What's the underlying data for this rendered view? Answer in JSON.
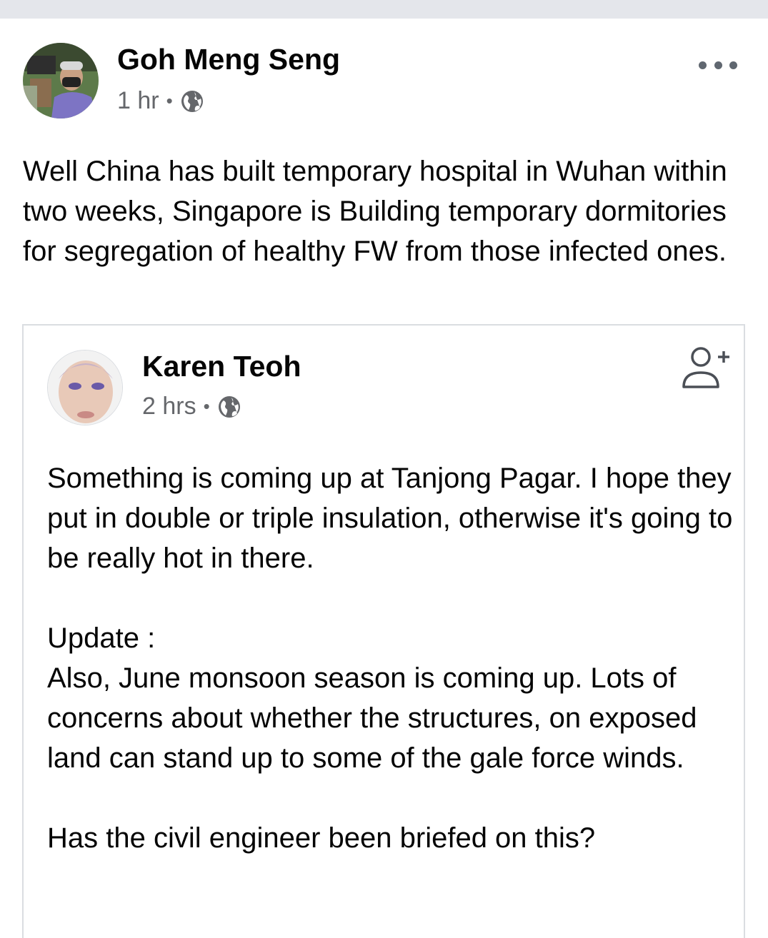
{
  "post": {
    "author": "Goh Meng Seng",
    "time": "1 hr",
    "separator": "•",
    "privacy_icon": "globe-icon",
    "menu_icon": "more-options-icon",
    "text": "Well China has built temporary hospital in Wuhan within two weeks, Singapore is Building temporary dormitories for segregation of healthy FW from those infected ones."
  },
  "shared_post": {
    "author": "Karen Teoh",
    "time": "2 hrs",
    "separator": "•",
    "privacy_icon": "globe-icon",
    "action_icon": "add-friend-icon",
    "paragraphs": [
      "Something is coming up at Tanjong Pagar. I hope they put in double or triple insulation, otherwise it's going to be really hot in there.",
      "Update :\nAlso, June monsoon season is coming up. Lots of concerns about whether the structures, on exposed land can stand up to some of the gale force winds.",
      "Has the civil engineer been briefed on this?"
    ]
  },
  "colors": {
    "background": "#ffffff",
    "top_strip": "#e4e6eb",
    "secondary_text": "#65676b",
    "primary_text": "#050505",
    "card_border": "#dadde1"
  }
}
